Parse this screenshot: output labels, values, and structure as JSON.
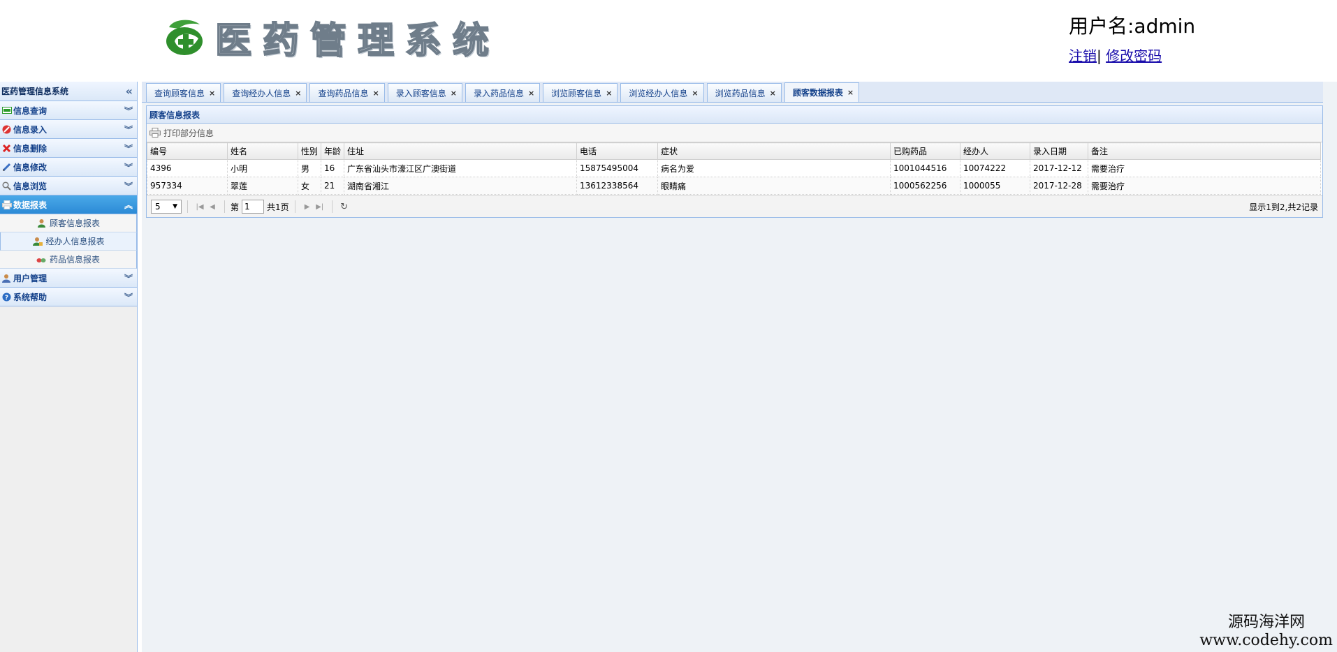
{
  "header": {
    "logo_title": "医药管理系统",
    "username": "用户名:admin",
    "logout": "注销",
    "separator": "|",
    "change_password": "修改密码"
  },
  "sidebar": {
    "title": "医药管理信息系统",
    "collapse_glyph": "«",
    "groups": [
      {
        "label": "信息查询",
        "icon": "card-icon",
        "color": "#2a9a2a"
      },
      {
        "label": "信息录入",
        "icon": "stop-icon",
        "color": "#d33"
      },
      {
        "label": "信息删除",
        "icon": "delete-x-icon",
        "color": "#d22"
      },
      {
        "label": "信息修改",
        "icon": "pencil-icon",
        "color": "#3a6fc4"
      },
      {
        "label": "信息浏览",
        "icon": "magnifier-icon",
        "color": "#777"
      },
      {
        "label": "数据报表",
        "icon": "printer-icon",
        "color": "#fff"
      },
      {
        "label": "用户管理",
        "icon": "user-icon",
        "color": "#c96"
      },
      {
        "label": "系统帮助",
        "icon": "help-icon",
        "color": "#2b6cc4"
      }
    ],
    "sub_items": [
      {
        "label": "顾客信息报表",
        "icon": "customer-icon"
      },
      {
        "label": "经办人信息报表",
        "icon": "agent-icon"
      },
      {
        "label": "药品信息报表",
        "icon": "medicine-icon"
      }
    ]
  },
  "tabs": [
    {
      "label": "查询顾客信息"
    },
    {
      "label": "查询经办人信息"
    },
    {
      "label": "查询药品信息"
    },
    {
      "label": "录入顾客信息"
    },
    {
      "label": "录入药品信息"
    },
    {
      "label": "浏览顾客信息"
    },
    {
      "label": "浏览经办人信息"
    },
    {
      "label": "浏览药品信息"
    },
    {
      "label": "顾客数据报表",
      "active": true
    }
  ],
  "panel": {
    "title": "顾客信息报表",
    "print_button": "打印部分信息"
  },
  "grid": {
    "columns": [
      "编号",
      "姓名",
      "性别",
      "年龄",
      "住址",
      "电话",
      "症状",
      "已购药品",
      "经办人",
      "录入日期",
      "备注"
    ],
    "rows": [
      [
        "4396",
        "小明",
        "男",
        "16",
        "广东省汕头市濠江区广澳街道",
        "15875495004",
        "病名为爱",
        "1001044516",
        "10074222",
        "2017-12-12",
        "需要治疗"
      ],
      [
        "957334",
        "翠莲",
        "女",
        "21",
        "湖南省湘江",
        "13612338564",
        "眼睛痛",
        "1000562256",
        "1000055",
        "2017-12-28",
        "需要治疗"
      ]
    ]
  },
  "pager": {
    "page_size": "5",
    "page_prefix": "第",
    "page_value": "1",
    "page_suffix": "共1页",
    "info": "显示1到2,共2记录"
  },
  "watermark": {
    "line1": "源码海洋网",
    "line2": "www.codehy.com"
  }
}
